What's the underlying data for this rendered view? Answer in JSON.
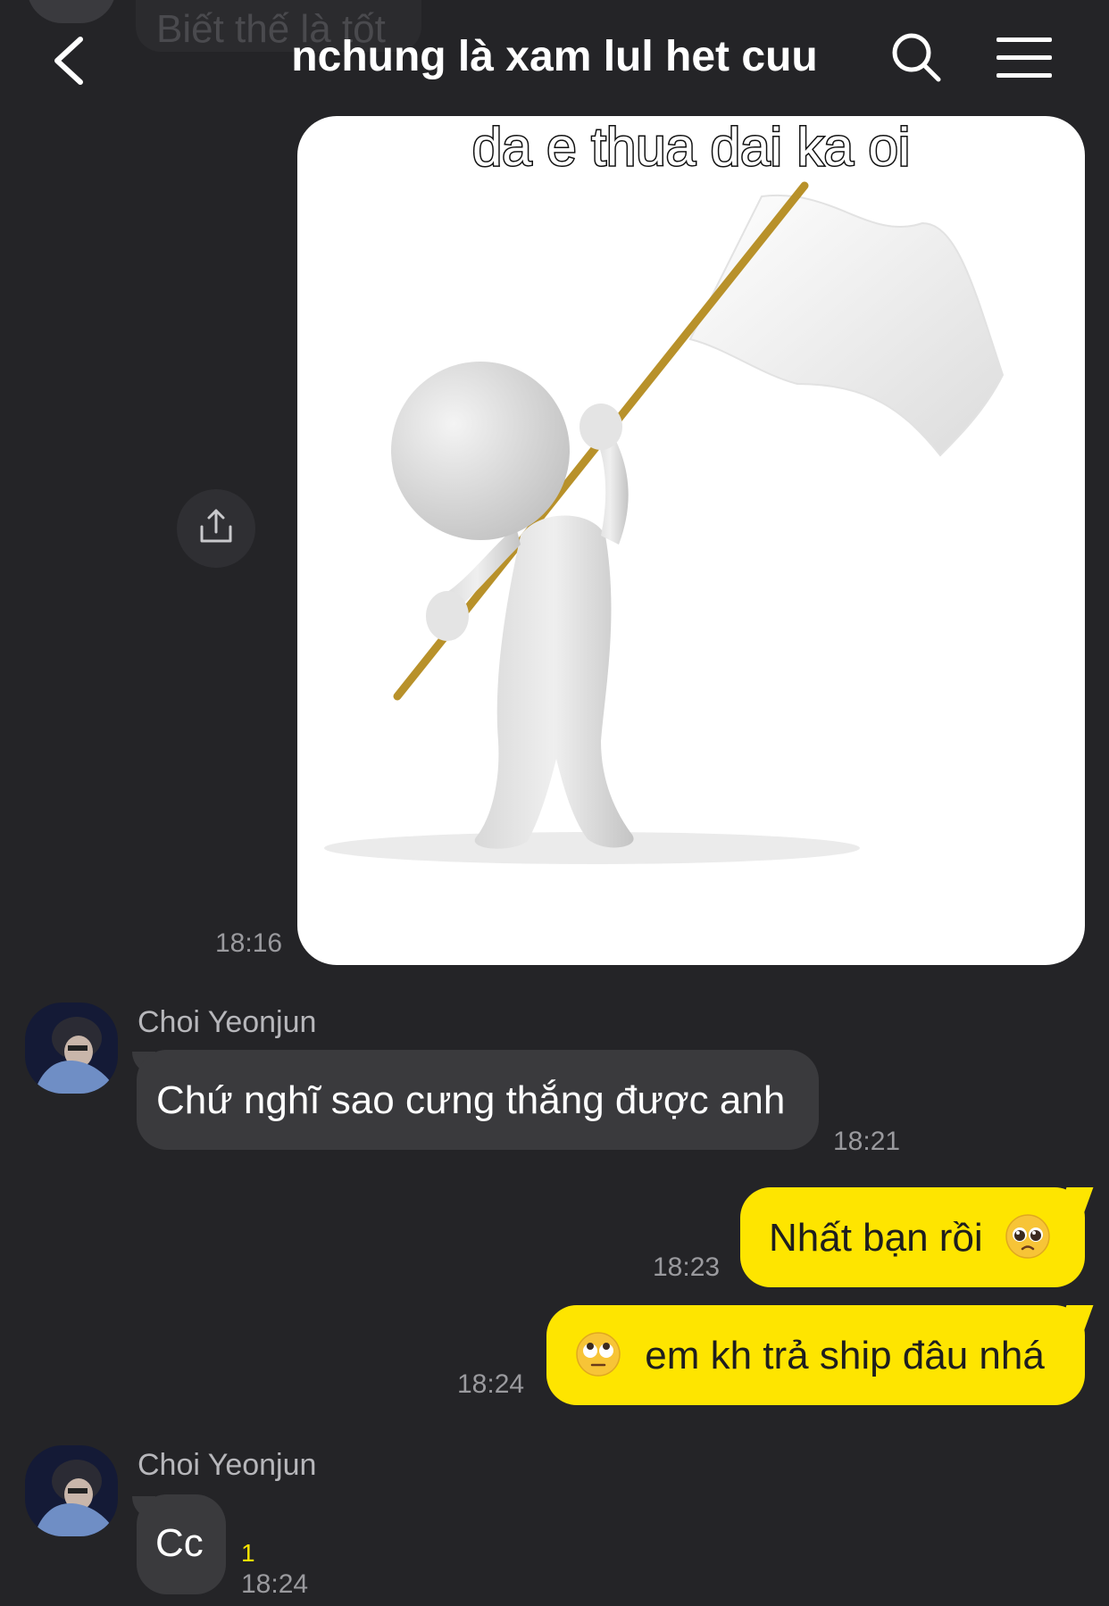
{
  "background_text": "Biết thế là tốt",
  "header": {
    "title": "nchung là xam lul het cuu",
    "back_icon": "chevron-left-icon",
    "search_icon": "search-icon",
    "menu_icon": "hamburger-menu-icon"
  },
  "colors": {
    "background": "#242427",
    "incoming_bubble": "#3a3a3d",
    "outgoing_bubble": "#fee500",
    "unread": "#fee500"
  },
  "messages": [
    {
      "type": "image",
      "direction": "out",
      "image_caption": "da e thua dai ka oi",
      "time": "18:16"
    },
    {
      "type": "text",
      "direction": "in",
      "sender": "Choi Yeonjun",
      "text": "Chứ nghĩ sao cưng thắng được anh",
      "time": "18:21"
    },
    {
      "type": "text",
      "direction": "out",
      "text": "Nhất bạn rồi",
      "emoji": "pleading-face",
      "time": "18:23"
    },
    {
      "type": "text",
      "direction": "out",
      "text": "em kh trả ship đâu nhá",
      "emoji": "face-with-rolling-eyes",
      "time": "18:24"
    },
    {
      "type": "text",
      "direction": "in",
      "sender": "Choi Yeonjun",
      "text": "Cc",
      "unread_count": "1",
      "time": "18:24"
    }
  ]
}
